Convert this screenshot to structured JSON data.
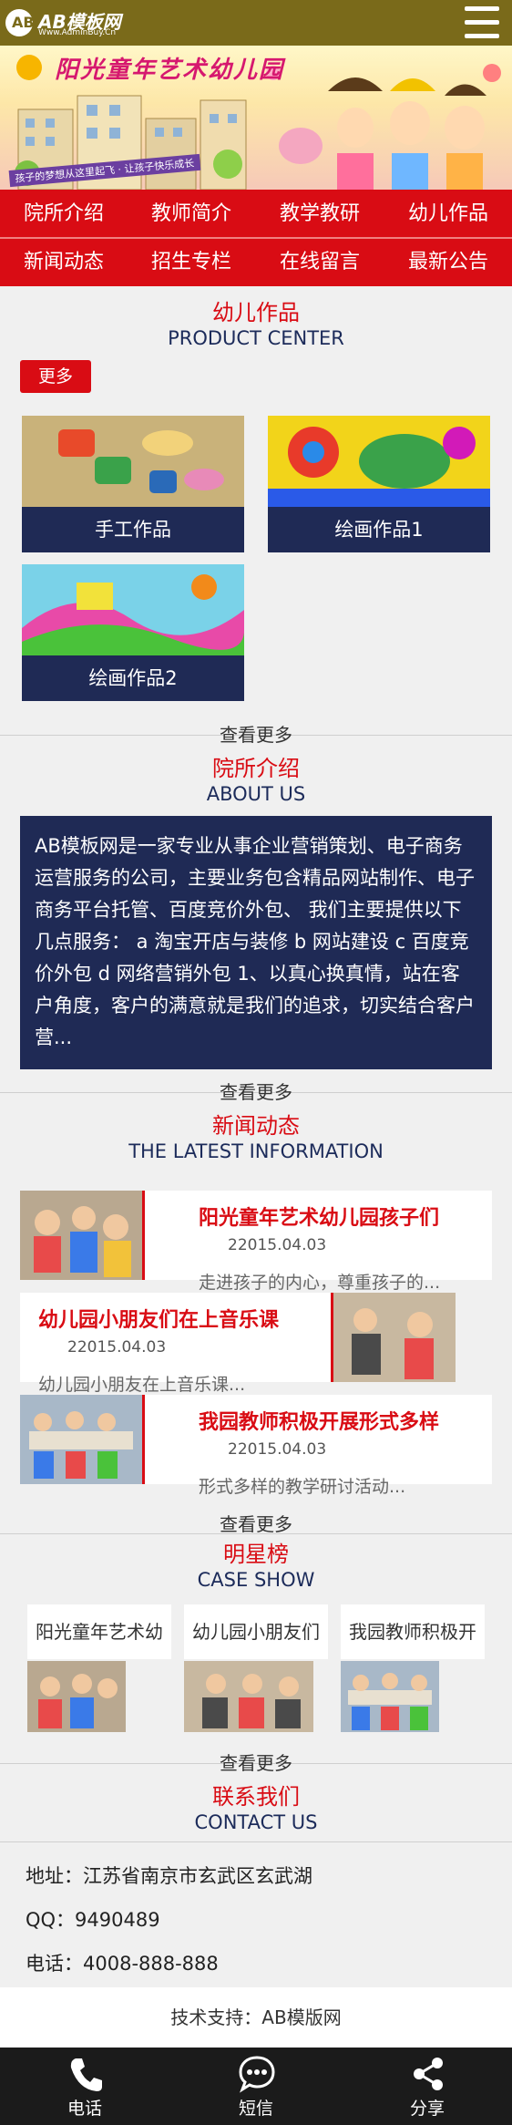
{
  "header": {
    "logo_mark": "AB",
    "logo_text": "AB模板网",
    "logo_sub": "Www.AdminBuy.Cn",
    "menu_icon": "hamburger-icon"
  },
  "banner": {
    "title": "阳光童年艺术幼儿园",
    "slogan": "孩子的梦想从这里起飞 · 让孩子快乐成长"
  },
  "nav": {
    "items": [
      "院所介绍",
      "教师简介",
      "教学教研",
      "幼儿作品",
      "新闻动态",
      "招生专栏",
      "在线留言",
      "最新公告"
    ]
  },
  "products": {
    "title_cn": "幼儿作品",
    "title_en": "PRODUCT CENTER",
    "more_label": "更多",
    "items": [
      {
        "caption": "手工作品"
      },
      {
        "caption": "绘画作品1"
      },
      {
        "caption": "绘画作品2"
      }
    ],
    "see_more": "查看更多"
  },
  "about": {
    "title_cn": "院所介绍",
    "title_en": "ABOUT US",
    "text": "AB模板网是一家专业从事企业营销策划、电子商务运营服务的公司，主要业务包含精品网站制作、电子商务平台托管、百度竞价外包、 我们主要提供以下几点服务： a 淘宝开店与装修 b 网站建设 c 百度竞价外包 d 网络营销外包 1、以真心换真情，站在客户角度，客户的满意就是我们的追求，切实结合客户营...",
    "see_more": "查看更多"
  },
  "news": {
    "title_cn": "新闻动态",
    "title_en": "THE LATEST INFORMATION",
    "items": [
      {
        "title": "阳光童年艺术幼儿园孩子们",
        "date": "22015.04.03",
        "desc": "走进孩子的内心，尊重孩子的..."
      },
      {
        "title": "幼儿园小朋友们在上音乐课",
        "date": "22015.04.03",
        "desc": "幼儿园小朋友在上音乐课..."
      },
      {
        "title": "我园教师积极开展形式多样",
        "date": "22015.04.03",
        "desc": "形式多样的教学研讨活动..."
      }
    ],
    "see_more": "查看更多"
  },
  "cases": {
    "title_cn": "明星榜",
    "title_en": "CASE SHOW",
    "items": [
      {
        "title": "阳光童年艺术幼"
      },
      {
        "title": "幼儿园小朋友们"
      },
      {
        "title": "我园教师积极开"
      }
    ],
    "see_more": "查看更多"
  },
  "contact": {
    "title_cn": "联系我们",
    "title_en": "CONTACT US",
    "address": "地址：江苏省南京市玄武区玄武湖",
    "qq": "QQ：9490489",
    "phone": "电话：4008-888-888"
  },
  "footer": {
    "support": "技术支持：AB模版网"
  },
  "bottom_bar": {
    "items": [
      {
        "label": "电话",
        "icon": "phone-icon"
      },
      {
        "label": "短信",
        "icon": "sms-icon"
      },
      {
        "label": "分享",
        "icon": "share-icon"
      }
    ]
  },
  "colors": {
    "header_bg": "#7a6a1a",
    "nav_bg": "#d90c14",
    "accent_red": "#d90c14",
    "navy": "#1f2a55",
    "bottom_bar_bg": "#1b1b1b"
  }
}
